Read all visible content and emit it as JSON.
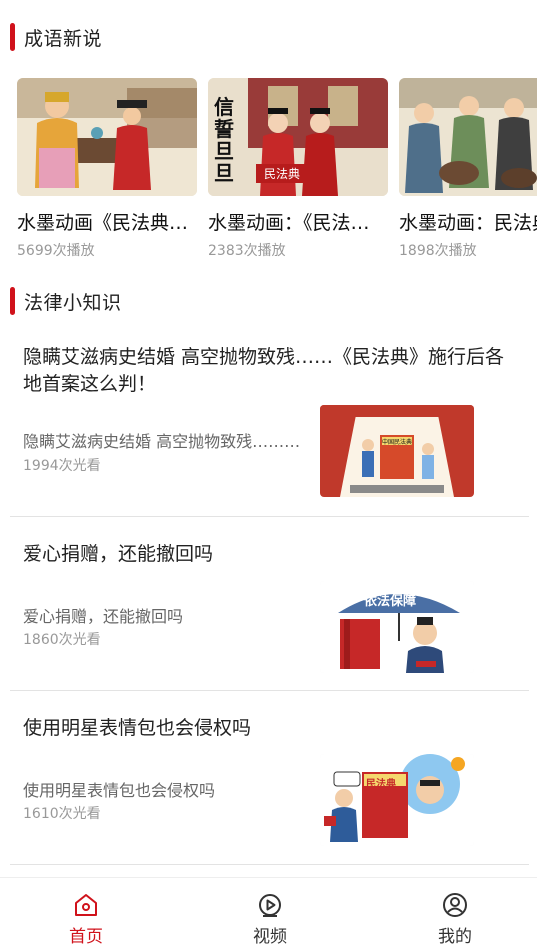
{
  "sections": {
    "idioms": {
      "title": "成语新说"
    },
    "law": {
      "title": "法律小知识"
    }
  },
  "videos": [
    {
      "title": "水墨动画《民法典》：成语新说…",
      "plays": "5699次播放"
    },
    {
      "title": "水墨动画：《民法典》成语新说",
      "plays": "2383次播放"
    },
    {
      "title": "水墨动画：民法典",
      "plays": "1898次播放"
    }
  ],
  "video_overlays": {
    "v2_banner": "民法典",
    "v2_calligraphy": "信誓旦旦"
  },
  "articles": [
    {
      "title": "隐瞒艾滋病史结婚 高空抛物致残……《民法典》施行后各地首案这么判！",
      "summary": "隐瞒艾滋病史结婚 高空抛物致残……《民法典》施行后各地首案这么判！",
      "views": "1994次光看"
    },
    {
      "title": "爱心捐赠，还能撤回吗",
      "summary": "爱心捐赠，还能撤回吗",
      "views": "1860次光看"
    },
    {
      "title": "使用明星表情包也会侵权吗",
      "summary": "使用明星表情包也会侵权吗",
      "views": "1610次光看"
    }
  ],
  "thumb_text": {
    "a1_sign": "中国民法典",
    "a2_umbrella": "依法保障",
    "a3_book": "民法典"
  },
  "tabbar": {
    "tabs": [
      {
        "label": "首页",
        "icon": "home-icon",
        "active": true
      },
      {
        "label": "视频",
        "icon": "play-circle-icon",
        "active": false
      },
      {
        "label": "我的",
        "icon": "user-icon",
        "active": false
      }
    ]
  },
  "colors": {
    "accent": "#d0121b",
    "divider": "#e3e3e3"
  }
}
